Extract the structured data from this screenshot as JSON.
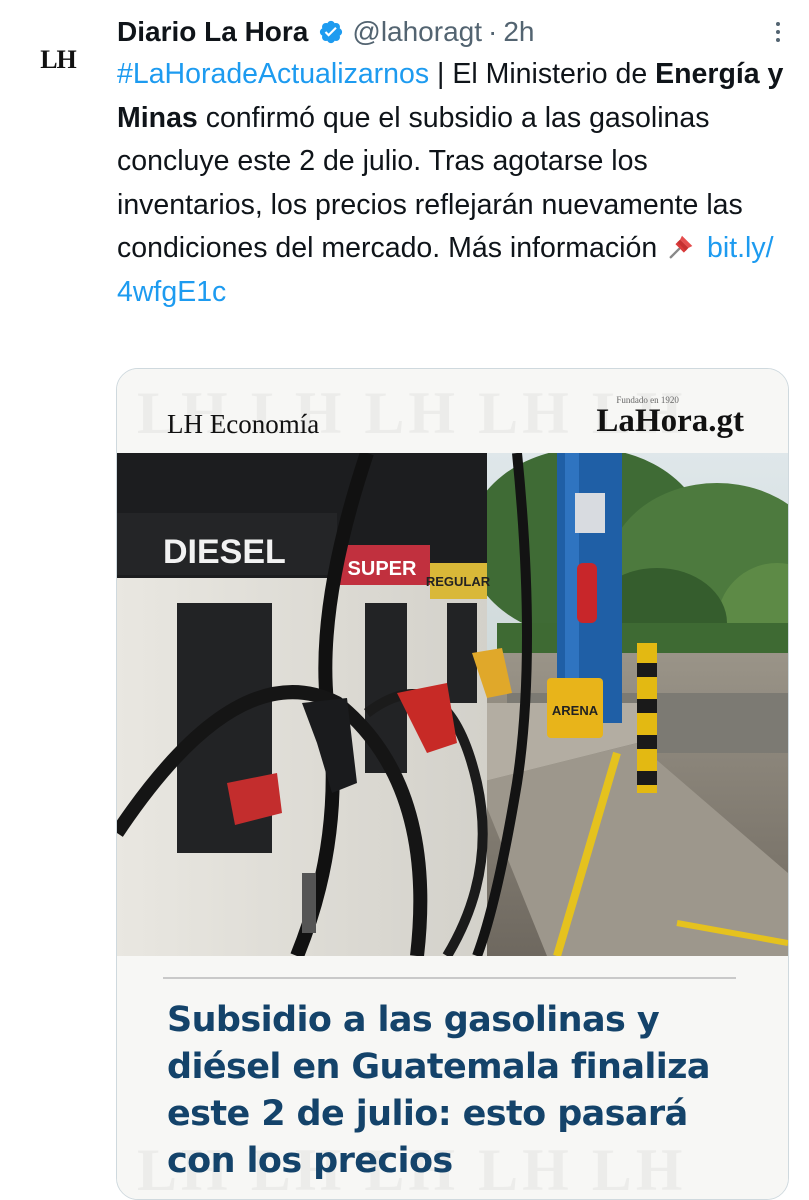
{
  "tweet": {
    "author_name": "Diario La Hora",
    "handle": "@lahoragt",
    "separator": "·",
    "time": "2h",
    "avatar_text": "LH",
    "text": {
      "hashtag": "#LaHoradeActualizarnos",
      "part1": " | El Ministerio de ",
      "bold": "Energía y Minas",
      "part2": " confirmó que el subsidio a las gasolinas concluye este 2 de julio. Tras agotarse los inventarios, los precios reflejarán nuevamente las condiciones del mercado. Más información ",
      "link": "bit.ly/ 4wfgE1c"
    }
  },
  "card": {
    "brand_left": "LH Economía",
    "brand_right": "LaHora.gt",
    "brand_right_sub": "Fundado en 1920",
    "watermark": "LH LH LH LH LH",
    "pump": {
      "diesel": "DIESEL",
      "super": "SUPER",
      "regular": "REGULAR",
      "sand": "ARENA"
    },
    "headline": "Subsidio a las gasolinas y diésel en Guatemala finaliza este 2 de julio: esto pasará con los precios"
  },
  "colors": {
    "link": "#1d9bf0",
    "headline": "#14436a",
    "verified": "#1d9bf0"
  }
}
